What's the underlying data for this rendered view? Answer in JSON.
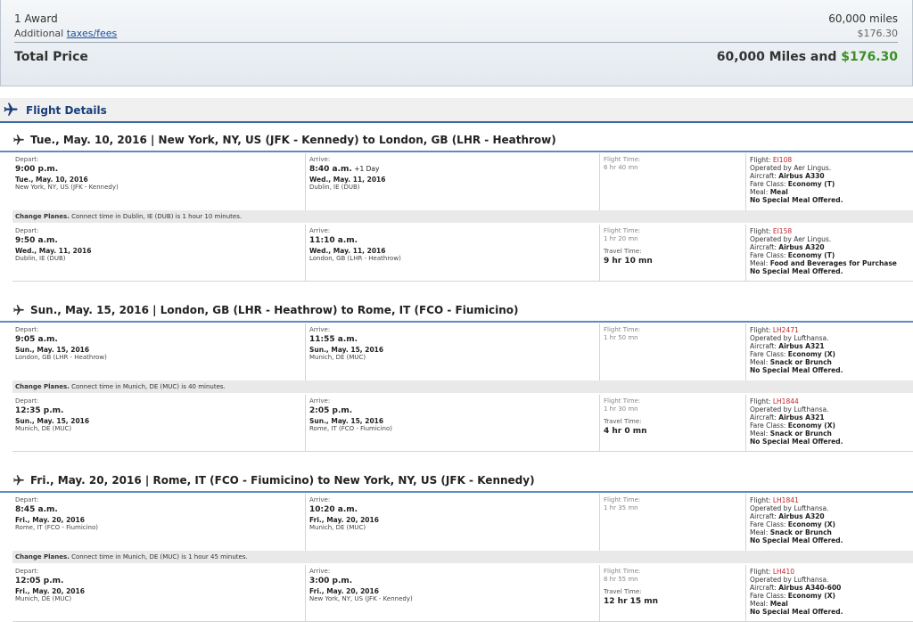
{
  "summary": {
    "award_label": "1 Award",
    "award_miles": "60,000 miles",
    "additional_prefix": "Additional ",
    "taxes_link": "taxes/fees",
    "additional_value": "$176.30",
    "total_label": "Total Price",
    "total_miles": "60,000 Miles and ",
    "total_cash": "$176.30"
  },
  "details": {
    "title": "Flight Details"
  },
  "labels": {
    "depart": "Depart:",
    "arrive": "Arrive:",
    "flight_time": "Flight Time:",
    "travel_time": "Travel Time:",
    "flight": "Flight: ",
    "aircraft": "Aircraft: ",
    "fare_class": "Fare Class: ",
    "meal": "Meal: ",
    "change_planes": "Change Planes."
  },
  "segments": [
    {
      "title": "Tue., May. 10, 2016 | New York, NY, US (JFK - Kennedy) to London, GB (LHR - Heathrow)",
      "change": "Connect time in Dublin, IE (DUB) is 1 hour 10 minutes.",
      "legs": [
        {
          "dep_time": "9:00 p.m.",
          "dep_date": "Tue., May. 10, 2016",
          "dep_place": "New York, NY, US (JFK - Kennedy)",
          "arr_time": "8:40 a.m.",
          "arr_extra": " +1 Day",
          "arr_date": "Wed., May. 11, 2016",
          "arr_place": "Dublin, IE (DUB)",
          "flight_time": "6 hr 40 mn",
          "travel_time": "",
          "flight_no": "EI108",
          "operated": "Operated by Aer Lingus.",
          "aircraft": "Airbus A330",
          "fare_class": "Economy (T)",
          "meal": "Meal",
          "special_meal": "No Special Meal Offered."
        },
        {
          "dep_time": "9:50 a.m.",
          "dep_date": "Wed., May. 11, 2016",
          "dep_place": "Dublin, IE (DUB)",
          "arr_time": "11:10 a.m.",
          "arr_extra": "",
          "arr_date": "Wed., May. 11, 2016",
          "arr_place": "London, GB (LHR - Heathrow)",
          "flight_time": "1 hr 20 mn",
          "travel_time": "9 hr 10 mn",
          "flight_no": "EI158",
          "operated": "Operated by Aer Lingus.",
          "aircraft": "Airbus A320",
          "fare_class": "Economy (T)",
          "meal": "Food and Beverages for Purchase",
          "special_meal": "No Special Meal Offered."
        }
      ]
    },
    {
      "title": "Sun., May. 15, 2016 | London, GB (LHR - Heathrow) to Rome, IT (FCO - Fiumicino)",
      "change": "Connect time in Munich, DE (MUC) is 40 minutes.",
      "legs": [
        {
          "dep_time": "9:05 a.m.",
          "dep_date": "Sun., May. 15, 2016",
          "dep_place": "London, GB (LHR - Heathrow)",
          "arr_time": "11:55 a.m.",
          "arr_extra": "",
          "arr_date": "Sun., May. 15, 2016",
          "arr_place": "Munich, DE (MUC)",
          "flight_time": "1 hr 50 mn",
          "travel_time": "",
          "flight_no": "LH2471",
          "operated": "Operated by Lufthansa.",
          "aircraft": "Airbus A321",
          "fare_class": "Economy (X)",
          "meal": "Snack or Brunch",
          "special_meal": "No Special Meal Offered."
        },
        {
          "dep_time": "12:35 p.m.",
          "dep_date": "Sun., May. 15, 2016",
          "dep_place": "Munich, DE (MUC)",
          "arr_time": "2:05 p.m.",
          "arr_extra": "",
          "arr_date": "Sun., May. 15, 2016",
          "arr_place": "Rome, IT (FCO - Fiumicino)",
          "flight_time": "1 hr 30 mn",
          "travel_time": "4 hr 0 mn",
          "flight_no": "LH1844",
          "operated": "Operated by Lufthansa.",
          "aircraft": "Airbus A321",
          "fare_class": "Economy (X)",
          "meal": "Snack or Brunch",
          "special_meal": "No Special Meal Offered."
        }
      ]
    },
    {
      "title": "Fri., May. 20, 2016 | Rome, IT (FCO - Fiumicino) to New York, NY, US (JFK - Kennedy)",
      "change": "Connect time in Munich, DE (MUC) is 1 hour 45 minutes.",
      "legs": [
        {
          "dep_time": "8:45 a.m.",
          "dep_date": "Fri., May. 20, 2016",
          "dep_place": "Rome, IT (FCO - Fiumicino)",
          "arr_time": "10:20 a.m.",
          "arr_extra": "",
          "arr_date": "Fri., May. 20, 2016",
          "arr_place": "Munich, DE (MUC)",
          "flight_time": "1 hr 35 mn",
          "travel_time": "",
          "flight_no": "LH1841",
          "operated": "Operated by Lufthansa.",
          "aircraft": "Airbus A320",
          "fare_class": "Economy (X)",
          "meal": "Snack or Brunch",
          "special_meal": "No Special Meal Offered."
        },
        {
          "dep_time": "12:05 p.m.",
          "dep_date": "Fri., May. 20, 2016",
          "dep_place": "Munich, DE (MUC)",
          "arr_time": "3:00 p.m.",
          "arr_extra": "",
          "arr_date": "Fri., May. 20, 2016",
          "arr_place": "New York, NY, US (JFK - Kennedy)",
          "flight_time": "8 hr 55 mn",
          "travel_time": "12 hr 15 mn",
          "flight_no": "LH410",
          "operated": "Operated by Lufthansa.",
          "aircraft": "Airbus A340-600",
          "fare_class": "Economy (X)",
          "meal": "Meal",
          "special_meal": "No Special Meal Offered."
        }
      ]
    }
  ]
}
